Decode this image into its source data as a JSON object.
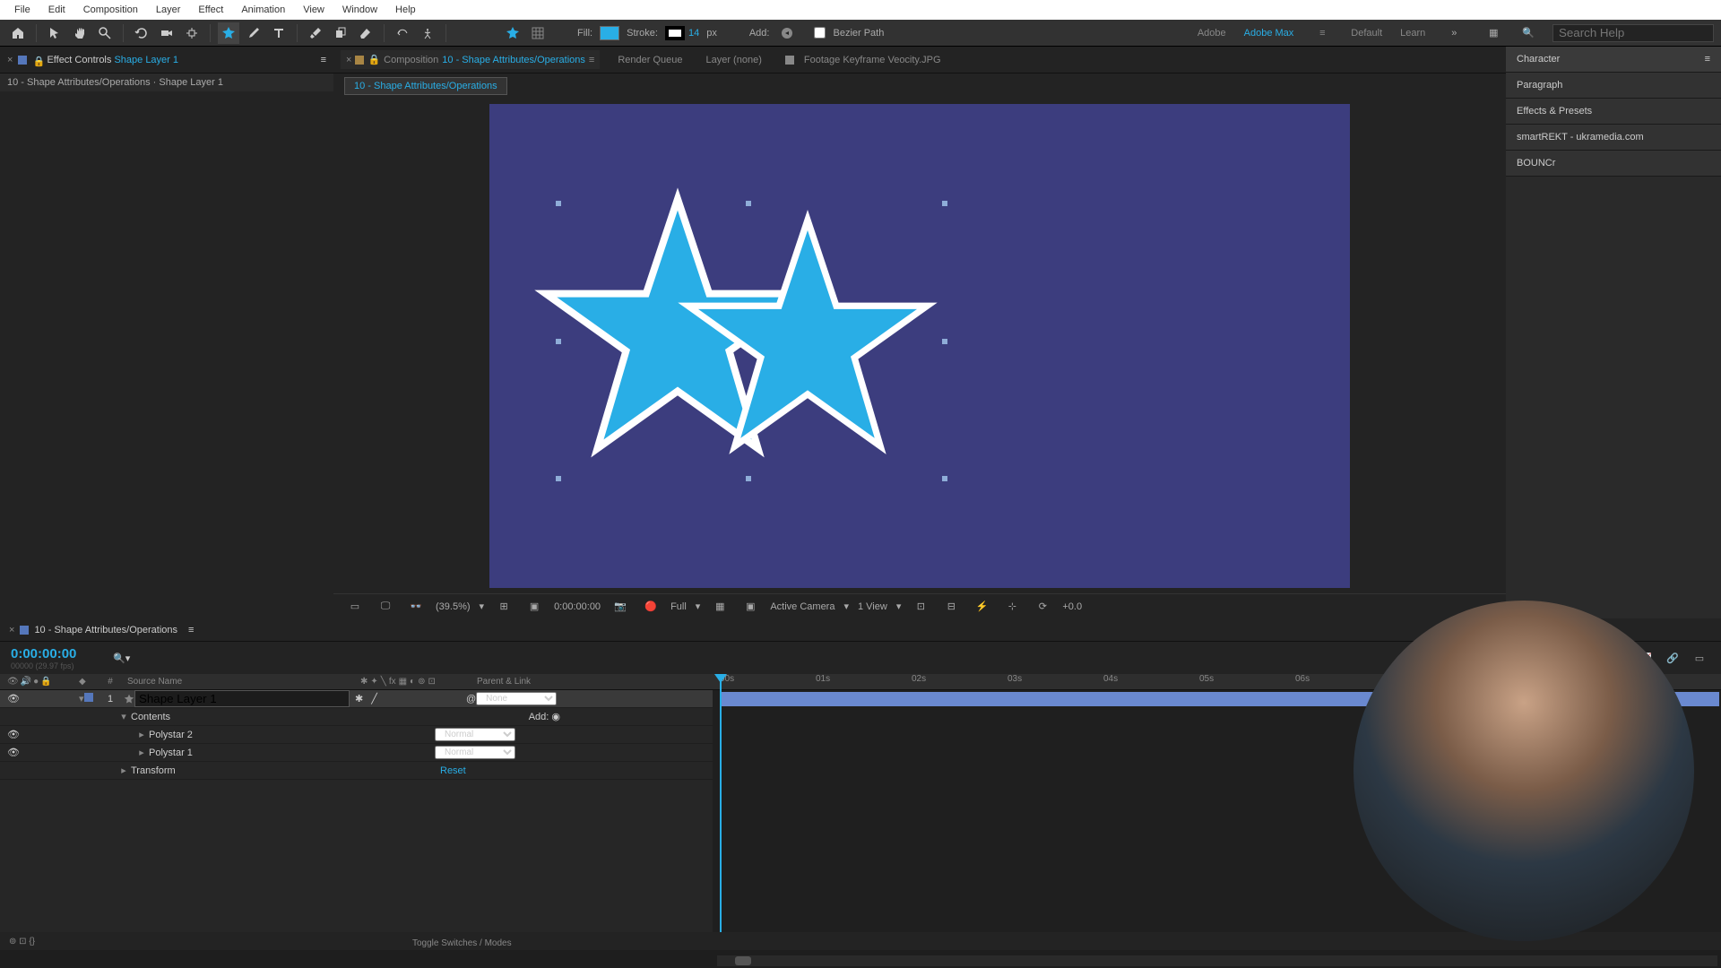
{
  "menu": {
    "file": "File",
    "edit": "Edit",
    "composition": "Composition",
    "layer": "Layer",
    "effect": "Effect",
    "animation": "Animation",
    "view": "View",
    "window": "Window",
    "help": "Help"
  },
  "toolbar": {
    "fill_label": "Fill:",
    "stroke_label": "Stroke:",
    "stroke_val": "14",
    "stroke_unit": "px",
    "add_label": "Add:",
    "bezier_label": "Bezier Path"
  },
  "workspace": {
    "adobe": "Adobe",
    "adobe_max": "Adobe Max",
    "default": "Default",
    "learn": "Learn",
    "search_ph": "Search Help"
  },
  "effects_panel": {
    "title": "Effect Controls",
    "layer": "Shape Layer 1",
    "breadcrumb_left": "10 - Shape Attributes/Operations",
    "breadcrumb_right": "Shape Layer 1"
  },
  "comp_tabs": {
    "composition": "Composition",
    "comp_name": "10 - Shape Attributes/Operations",
    "render_queue": "Render Queue",
    "layer_none": "Layer  (none)",
    "footage": "Footage  Keyframe Veocity.JPG",
    "flow": "10 - Shape Attributes/Operations"
  },
  "viewer_bar": {
    "zoom": "(39.5%)",
    "time": "0:00:00:00",
    "res": "Full",
    "camera": "Active Camera",
    "views": "1 View",
    "exp": "+0.0"
  },
  "right_panels": {
    "character": "Character",
    "paragraph": "Paragraph",
    "effects": "Effects & Presets",
    "smartrekt": "smartREKT - ukramedia.com",
    "bouncr": "BOUNCr"
  },
  "timeline": {
    "comp_name": "10 - Shape Attributes/Operations",
    "time": "0:00:00:00",
    "time_sub": "00000 (29.97 fps)",
    "cols": {
      "num": "#",
      "source": "Source Name",
      "parent": "Parent & Link"
    },
    "layer1": {
      "num": "1",
      "name": "Shape Layer 1",
      "mode": "None"
    },
    "contents": "Contents",
    "add": "Add:",
    "polystar2": "Polystar 2",
    "polystar1": "Polystar 1",
    "transform": "Transform",
    "normal": "Normal",
    "reset": "Reset",
    "ruler": [
      "00s",
      "01s",
      "02s",
      "03s",
      "04s",
      "05s",
      "06s"
    ],
    "toggle": "Toggle Switches / Modes"
  }
}
